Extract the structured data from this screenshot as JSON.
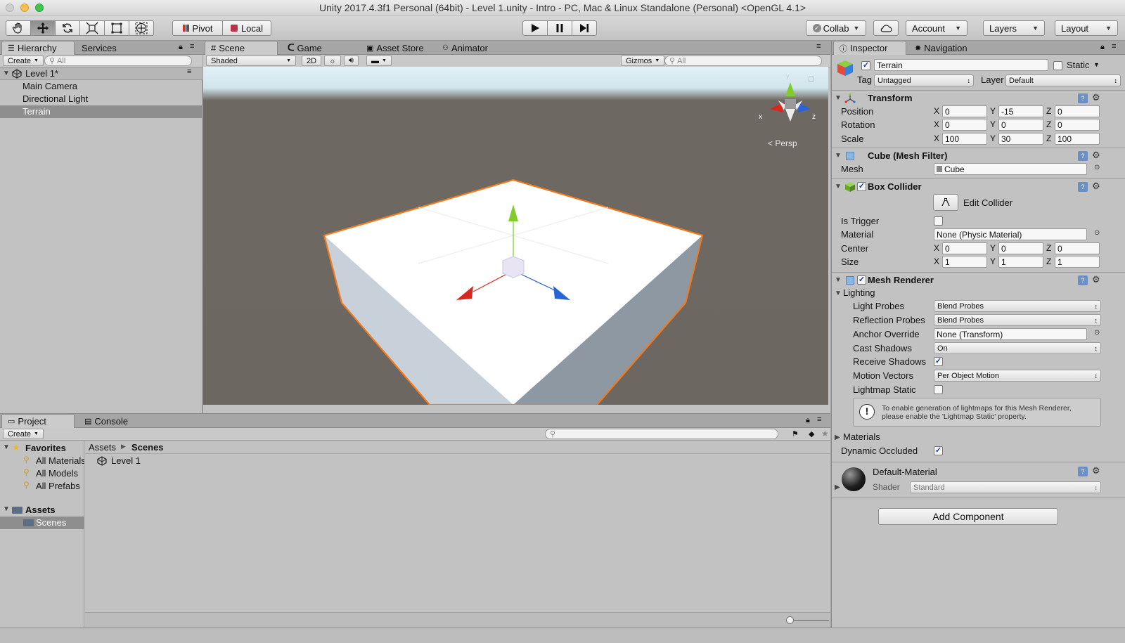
{
  "window": {
    "title": "Unity 2017.4.3f1 Personal (64bit) - Level 1.unity - Intro - PC, Mac & Linux Standalone (Personal) <OpenGL 4.1>"
  },
  "toolbar": {
    "tools": [
      "hand-tool",
      "move-tool",
      "rotate-tool",
      "scale-tool",
      "rect-tool",
      "transform-tool"
    ],
    "pivot_label": "Pivot",
    "local_label": "Local",
    "collab_label": "Collab",
    "account_label": "Account",
    "layers_label": "Layers",
    "layout_label": "Layout"
  },
  "hierarchy": {
    "tab_label": "Hierarchy",
    "services_tab_label": "Services",
    "create_label": "Create",
    "search_placeholder": "All",
    "scene_name": "Level 1*",
    "items": [
      {
        "label": "Main Camera",
        "selected": false
      },
      {
        "label": "Directional Light",
        "selected": false
      },
      {
        "label": "Terrain",
        "selected": true
      }
    ]
  },
  "scene": {
    "tabs": [
      "Scene",
      "Game",
      "Asset Store",
      "Animator"
    ],
    "shading_mode": "Shaded",
    "mode_2d_label": "2D",
    "gizmos_label": "Gizmos",
    "search_placeholder": "All",
    "persp_label": "Persp",
    "axis_x": "x",
    "axis_y": "y",
    "axis_z": "z"
  },
  "project": {
    "tab_label": "Project",
    "console_tab_label": "Console",
    "create_label": "Create",
    "favorites_label": "Favorites",
    "favorites": [
      "All Materials",
      "All Models",
      "All Prefabs"
    ],
    "assets_label": "Assets",
    "asset_folders": [
      "Scenes"
    ],
    "breadcrumb": [
      "Assets",
      "Scenes"
    ],
    "files": [
      "Level 1"
    ]
  },
  "inspector": {
    "tab_label": "Inspector",
    "navigation_tab_label": "Navigation",
    "object_name": "Terrain",
    "static_label": "Static",
    "tag_label": "Tag",
    "tag_value": "Untagged",
    "layer_label": "Layer",
    "layer_value": "Default",
    "transform": {
      "title": "Transform",
      "position_label": "Position",
      "rotation_label": "Rotation",
      "scale_label": "Scale",
      "axis_x": "X",
      "axis_y": "Y",
      "axis_z": "Z",
      "position": [
        "0",
        "-15",
        "0"
      ],
      "rotation": [
        "0",
        "0",
        "0"
      ],
      "scale": [
        "100",
        "30",
        "100"
      ]
    },
    "mesh_filter": {
      "title": "Cube (Mesh Filter)",
      "mesh_label": "Mesh",
      "mesh_value": "Cube"
    },
    "box_collider": {
      "title": "Box Collider",
      "edit_collider_label": "Edit Collider",
      "is_trigger_label": "Is Trigger",
      "material_label": "Material",
      "material_value": "None (Physic Material)",
      "center_label": "Center",
      "center": [
        "0",
        "0",
        "0"
      ],
      "size_label": "Size",
      "size": [
        "1",
        "1",
        "1"
      ]
    },
    "mesh_renderer": {
      "title": "Mesh Renderer",
      "lighting_label": "Lighting",
      "light_probes_label": "Light Probes",
      "light_probes_value": "Blend Probes",
      "reflection_probes_label": "Reflection Probes",
      "reflection_probes_value": "Blend Probes",
      "anchor_override_label": "Anchor Override",
      "anchor_override_value": "None (Transform)",
      "cast_shadows_label": "Cast Shadows",
      "cast_shadows_value": "On",
      "receive_shadows_label": "Receive Shadows",
      "motion_vectors_label": "Motion Vectors",
      "motion_vectors_value": "Per Object Motion",
      "lightmap_static_label": "Lightmap Static",
      "info_text_1": "To enable generation of lightmaps for this Mesh Renderer,",
      "info_text_2": "please enable the 'Lightmap Static' property.",
      "materials_label": "Materials",
      "dynamic_occluded_label": "Dynamic Occluded"
    },
    "material": {
      "name": "Default-Material",
      "shader_label": "Shader",
      "shader_value": "Standard"
    },
    "add_component_label": "Add Component"
  },
  "colors": {
    "selection_outline": "#f07a1e",
    "axis_x": "#d6281e",
    "axis_y": "#7fcc2a",
    "axis_z": "#2a62d8",
    "panel_bg": "#c2c2c2"
  }
}
